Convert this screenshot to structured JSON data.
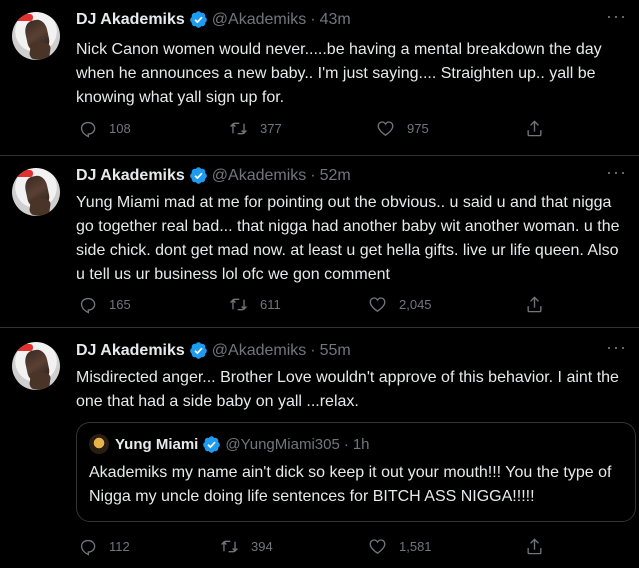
{
  "tweets": [
    {
      "name": "DJ Akademiks",
      "handle": "@Akademiks",
      "time": "43m",
      "text": "Nick Canon women would never.....be having a mental breakdown the day when he announces a new baby.. I'm just saying.... Straighten up.. yall be knowing what yall sign up for.",
      "replies": "108",
      "retweets": "377",
      "likes": "975"
    },
    {
      "name": "DJ Akademiks",
      "handle": "@Akademiks",
      "time": "52m",
      "text": "Yung Miami mad at me for pointing out the obvious.. u said u and that nigga go together real bad... that nigga had another baby wit another woman. u the side chick. dont get mad now. at least u get hella gifts. live ur life queen. Also u tell us ur business lol ofc we gon comment",
      "replies": "165",
      "retweets": "611",
      "likes": "2,045"
    },
    {
      "name": "DJ Akademiks",
      "handle": "@Akademiks",
      "time": "55m",
      "text": "Misdirected anger... Brother Love wouldn't approve of this behavior. I aint the one that had a side baby on yall ...relax.",
      "replies": "112",
      "retweets": "394",
      "likes": "1,581",
      "quote": {
        "name": "Yung Miami",
        "handle": "@YungMiami305",
        "time": "1h",
        "text": "Akademiks my name ain't dick so keep it out your mouth!!! You the type of Nigga my uncle doing life sentences for BITCH ASS NIGGA!!!!!"
      }
    }
  ],
  "separator": "·",
  "more_glyph": "···",
  "icons": [
    "verified-icon",
    "reply-icon",
    "retweet-icon",
    "like-icon",
    "share-icon",
    "more-icon"
  ],
  "colors": {
    "background": "#000000",
    "text": "#e7e9ea",
    "muted": "#71767b",
    "verified": "#1d9bf0",
    "border": "#2f3336"
  }
}
